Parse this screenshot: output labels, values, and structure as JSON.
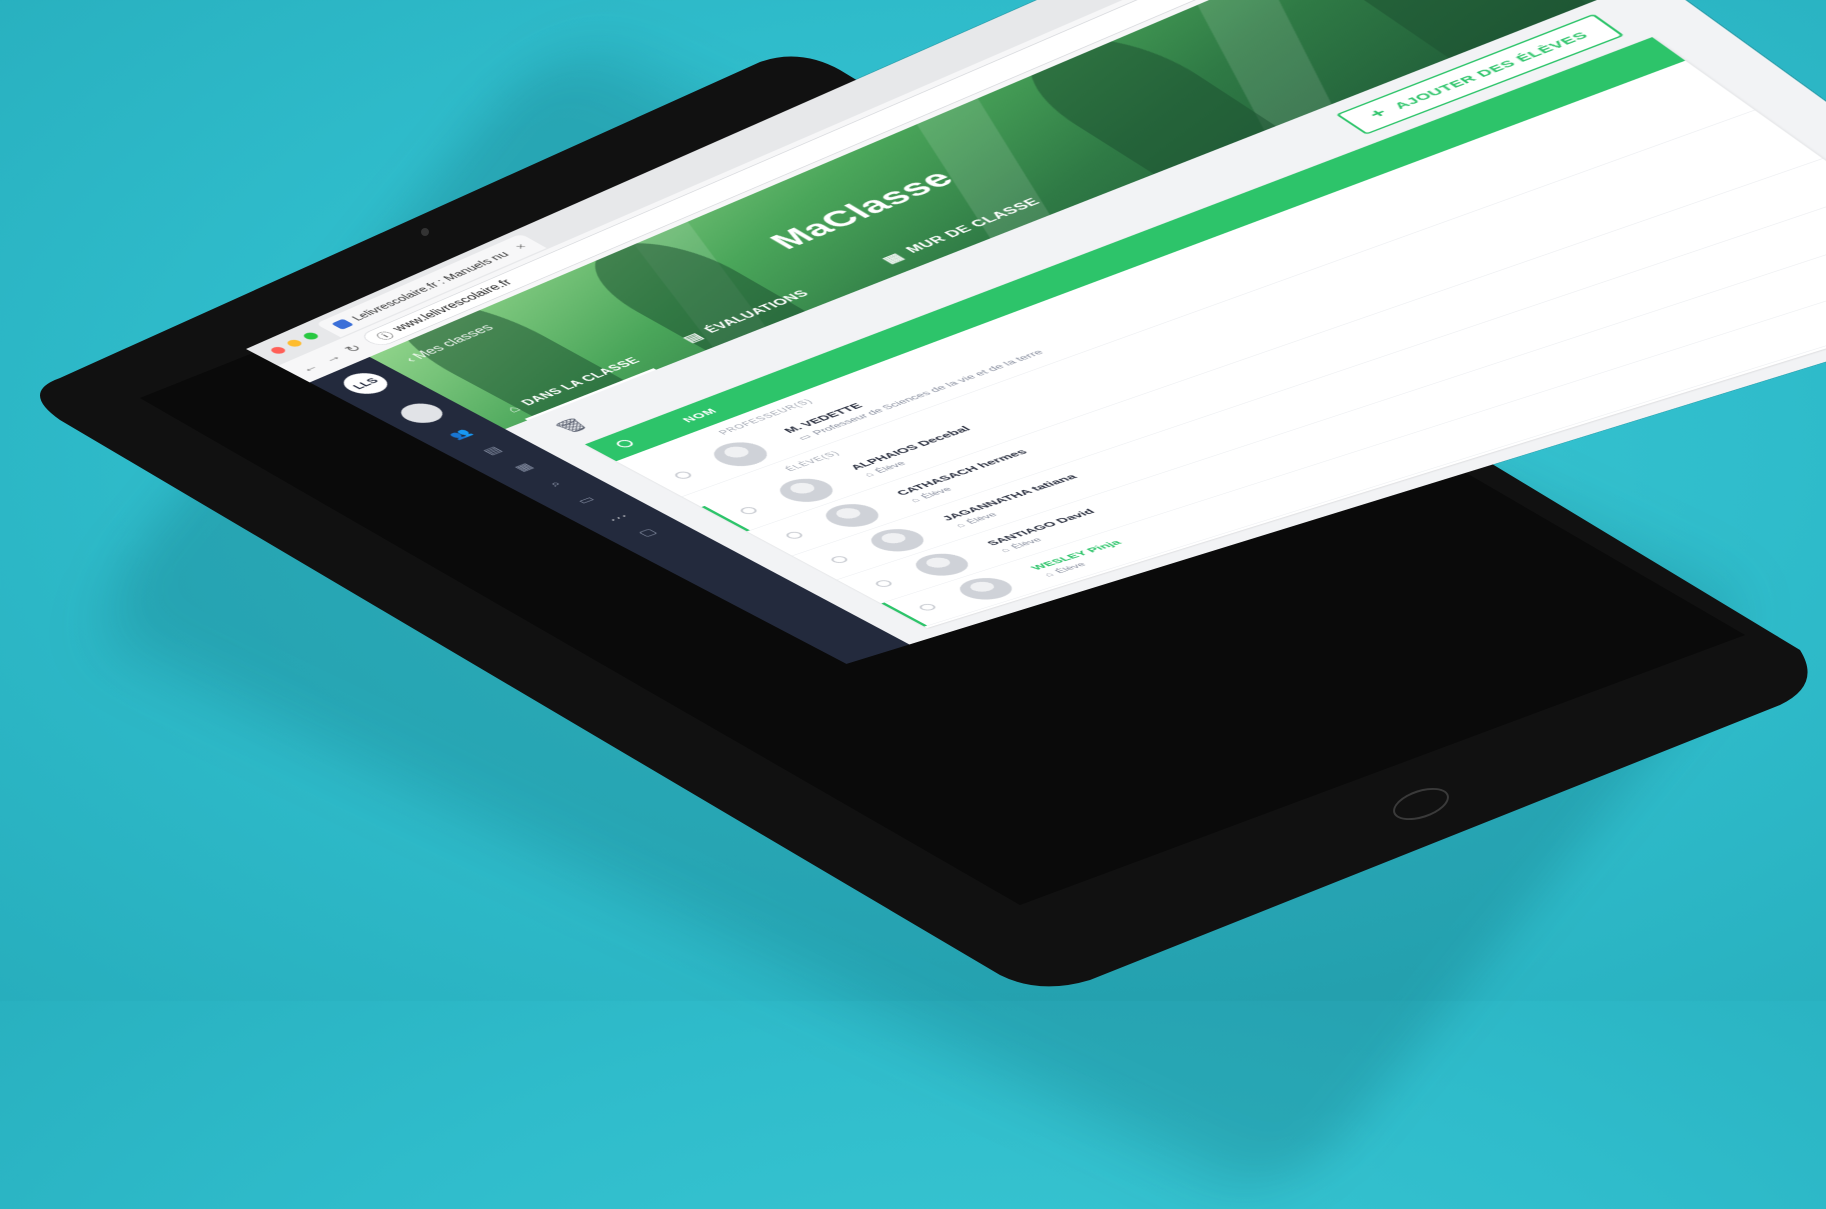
{
  "browser": {
    "tab_title": "Lelivrescolaire.fr : Manuels nu",
    "tab_close": "×",
    "url": "www.lelivrescolaire.fr",
    "ext_ebay": "ebay"
  },
  "sidebar": {
    "logo_text": "LLS",
    "more": "..."
  },
  "banner": {
    "back_link": "Mes classes",
    "class_title": "MaClasse",
    "tabs": [
      {
        "label": "DANS LA CLASSE"
      },
      {
        "label": "ÉVALUATIONS"
      },
      {
        "label": "MUR DE CLASSE"
      }
    ]
  },
  "content": {
    "add_button": "AJOUTER DES ÉLÈVES",
    "table": {
      "header_name": "NOM",
      "teachers_label": "PROFESSEUR(S)",
      "students_label": "ÉLÈVE(S)",
      "teacher": {
        "name": "M. VEDETTE",
        "role": "Professeur de Sciences de la vie et de la terre"
      },
      "students": [
        {
          "name": "ALPHAIOS Decebal",
          "role": "Élève"
        },
        {
          "name": "CATHASACH hermes",
          "role": "Élève"
        },
        {
          "name": "JAGANNATHA tatiana",
          "role": "Élève"
        },
        {
          "name": "SANTIAGO David",
          "role": "Élève"
        },
        {
          "name": "WESLEY Pinja",
          "role": "Élève"
        }
      ]
    }
  },
  "colors": {
    "background": "#2fbccb",
    "accent_green": "#2dc46a",
    "sidebar": "#232a3d",
    "tablet_bezel": "#111111"
  },
  "icons": {
    "nav": [
      "back-arrow-icon",
      "forward-arrow-icon",
      "reload-icon",
      "info-icon",
      "star-icon",
      "menu-dots-icon"
    ],
    "sidebar": [
      "logo-icon",
      "users-icon",
      "book-icon",
      "calendar-icon",
      "search-icon",
      "document-icon",
      "folder-icon"
    ],
    "tabs": [
      "class-icon",
      "document-icon",
      "wall-icon"
    ],
    "content": [
      "trash-icon",
      "plus-icon",
      "student-cap-icon"
    ]
  }
}
